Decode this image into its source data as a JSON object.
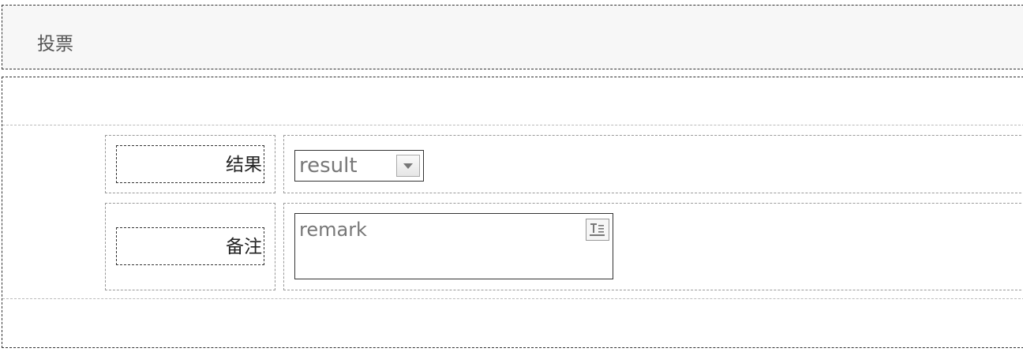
{
  "panel": {
    "title": "投票"
  },
  "form": {
    "fields": [
      {
        "label": "结果",
        "control": "select",
        "value": "result",
        "icon": "chevron-down-icon"
      },
      {
        "label": "备注",
        "control": "textarea",
        "value": "remark",
        "icon": "text-field-icon"
      }
    ]
  }
}
